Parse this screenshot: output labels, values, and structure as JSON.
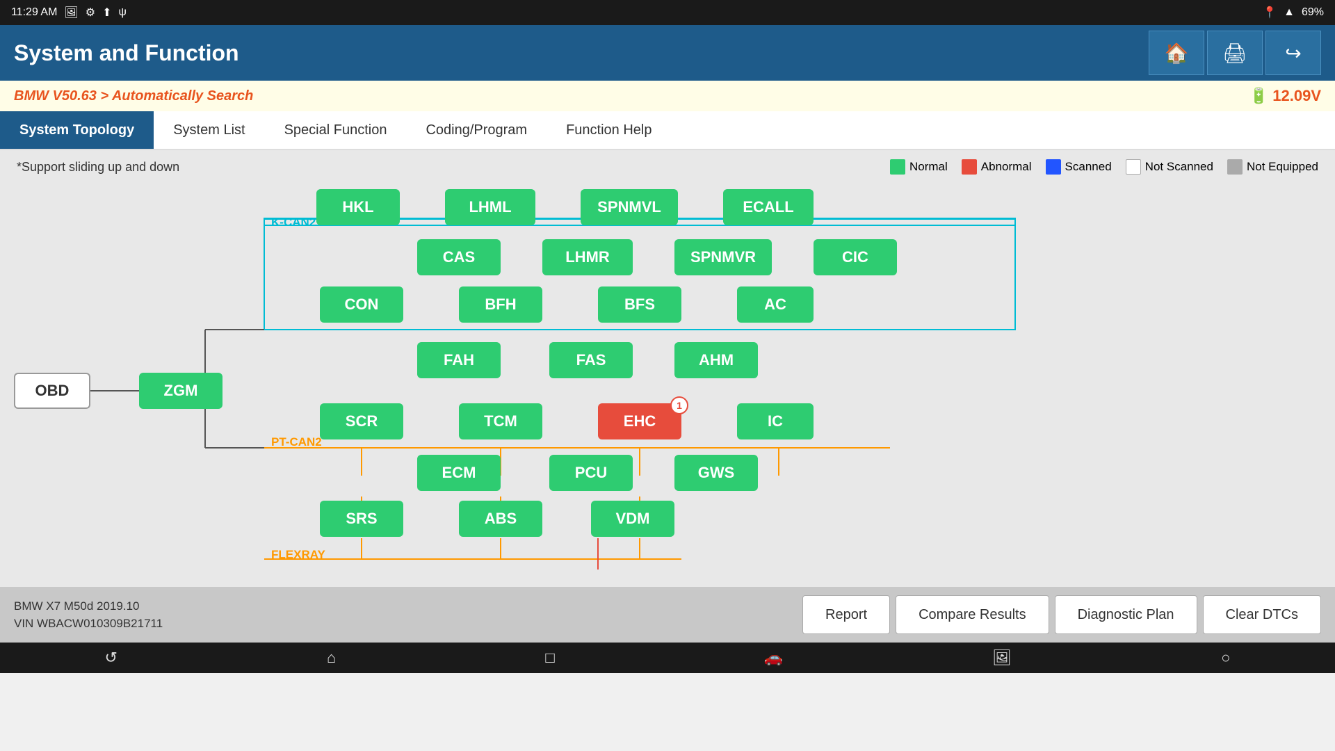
{
  "status_bar": {
    "time": "11:29 AM",
    "battery": "69%"
  },
  "header": {
    "title": "System and Function",
    "icons": [
      "home",
      "print",
      "exit"
    ]
  },
  "breadcrumb": {
    "text": "BMW V50.63 > Automatically Search",
    "voltage": "12.09V"
  },
  "tabs": [
    {
      "label": "System Topology",
      "active": true
    },
    {
      "label": "System List",
      "active": false
    },
    {
      "label": "Special Function",
      "active": false
    },
    {
      "label": "Coding/Program",
      "active": false
    },
    {
      "label": "Function Help",
      "active": false
    }
  ],
  "info_bar": {
    "support_text": "*Support sliding up and down",
    "legend": [
      {
        "label": "Normal",
        "color": "#2ecc71"
      },
      {
        "label": "Abnormal",
        "color": "#e74c3c"
      },
      {
        "label": "Scanned",
        "color": "#2255ff"
      },
      {
        "label": "Not Scanned",
        "color": "#ffffff"
      },
      {
        "label": "Not Equipped",
        "color": "#aaaaaa"
      }
    ]
  },
  "bus_labels": [
    {
      "id": "kcan2",
      "text": "K-CAN2",
      "type": "cyan"
    },
    {
      "id": "ptcan2",
      "text": "PT-CAN2",
      "type": "orange"
    },
    {
      "id": "flexray",
      "text": "FLEXRAY",
      "type": "orange"
    }
  ],
  "nodes": [
    {
      "id": "HKL",
      "label": "HKL",
      "color": "green"
    },
    {
      "id": "LHML",
      "label": "LHML",
      "color": "green"
    },
    {
      "id": "SPNMVL",
      "label": "SPNMVL",
      "color": "green"
    },
    {
      "id": "ECALL",
      "label": "ECALL",
      "color": "green"
    },
    {
      "id": "CAS",
      "label": "CAS",
      "color": "green"
    },
    {
      "id": "LHMR",
      "label": "LHMR",
      "color": "green"
    },
    {
      "id": "SPNMVR",
      "label": "SPNMVR",
      "color": "green"
    },
    {
      "id": "CIC",
      "label": "CIC",
      "color": "green"
    },
    {
      "id": "CON",
      "label": "CON",
      "color": "green"
    },
    {
      "id": "BFH",
      "label": "BFH",
      "color": "green"
    },
    {
      "id": "BFS",
      "label": "BFS",
      "color": "green"
    },
    {
      "id": "AC",
      "label": "AC",
      "color": "green"
    },
    {
      "id": "FAH",
      "label": "FAH",
      "color": "green"
    },
    {
      "id": "FAS",
      "label": "FAS",
      "color": "green"
    },
    {
      "id": "AHM",
      "label": "AHM",
      "color": "green"
    },
    {
      "id": "OBD",
      "label": "OBD",
      "color": "white"
    },
    {
      "id": "ZGM",
      "label": "ZGM",
      "color": "green"
    },
    {
      "id": "SCR",
      "label": "SCR",
      "color": "green"
    },
    {
      "id": "TCM",
      "label": "TCM",
      "color": "green"
    },
    {
      "id": "EHC",
      "label": "EHC",
      "color": "red",
      "badge": "1"
    },
    {
      "id": "IC",
      "label": "IC",
      "color": "green"
    },
    {
      "id": "ECM",
      "label": "ECM",
      "color": "green"
    },
    {
      "id": "PCU",
      "label": "PCU",
      "color": "green"
    },
    {
      "id": "GWS",
      "label": "GWS",
      "color": "green"
    },
    {
      "id": "SRS",
      "label": "SRS",
      "color": "green"
    },
    {
      "id": "ABS",
      "label": "ABS",
      "color": "green"
    },
    {
      "id": "VDM",
      "label": "VDM",
      "color": "green"
    }
  ],
  "action_buttons": [
    {
      "id": "report",
      "label": "Report"
    },
    {
      "id": "compare",
      "label": "Compare Results"
    },
    {
      "id": "diag_plan",
      "label": "Diagnostic Plan"
    },
    {
      "id": "clear_dtcs",
      "label": "Clear DTCs"
    }
  ],
  "vehicle_info": {
    "line1": "BMW X7 M50d 2019.10",
    "line2": "VIN WBACW010309B21711"
  },
  "nav_icons": [
    "back",
    "home",
    "square",
    "car",
    "image",
    "circle"
  ]
}
